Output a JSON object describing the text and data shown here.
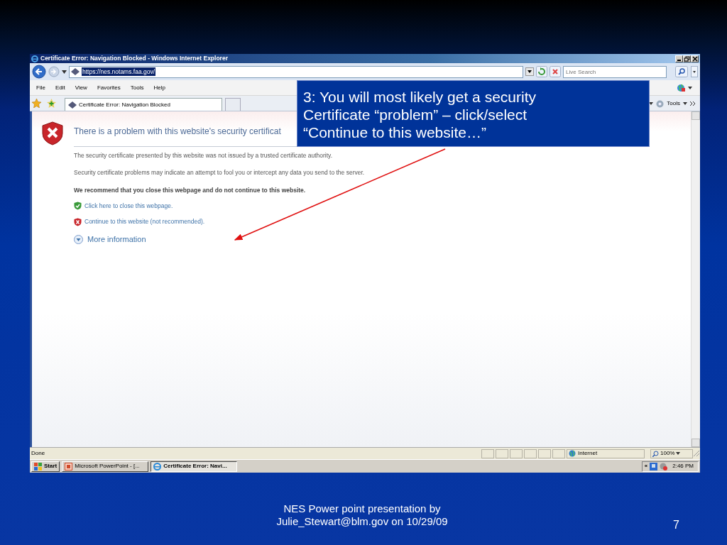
{
  "window": {
    "title": "Certificate Error: Navigation Blocked - Windows Internet Explorer"
  },
  "address_bar": {
    "url": "https://nes.notams.faa.gov/",
    "search_placeholder": "Live Search"
  },
  "menu": [
    "File",
    "Edit",
    "View",
    "Favorites",
    "Tools",
    "Help"
  ],
  "tabs": [
    {
      "label": "Certificate Error: Navigation Blocked",
      "selected": true
    }
  ],
  "toolbar": {
    "tools": "Tools"
  },
  "page": {
    "heading": "There is a problem with this website's security certificat",
    "paragraphs": [
      "The security certificate presented by this website was not issued by a trusted certificate authority.",
      "Security certificate problems may indicate an attempt to fool you or intercept any data you send to the server."
    ],
    "recommendation": "We recommend that you close this webpage and do not continue to this website.",
    "links": [
      {
        "kind": "safe",
        "label": "Click here to close this webpage."
      },
      {
        "kind": "danger",
        "label": "Continue to this website (not recommended)."
      }
    ],
    "more": "More information"
  },
  "status_bar": {
    "status": "Done",
    "zone": "Internet",
    "zoom": "100%"
  },
  "taskbar": {
    "start": "Start",
    "buttons": [
      {
        "label": "Microsoft PowerPoint - [...",
        "selected": false
      },
      {
        "label": "Certificate Error: Navi...",
        "selected": true
      }
    ],
    "tray_toggle": "«",
    "clock": "2:46 PM"
  },
  "callout": {
    "lines": [
      "3:  You will most likely get a security",
      "Certificate “problem” – click/select",
      "“Continue to this website…”"
    ]
  },
  "footer": {
    "lines": [
      "NES Power point presentation by",
      "Julie_Stewart@blm.gov on 10/29/09"
    ],
    "page_number": "7"
  }
}
